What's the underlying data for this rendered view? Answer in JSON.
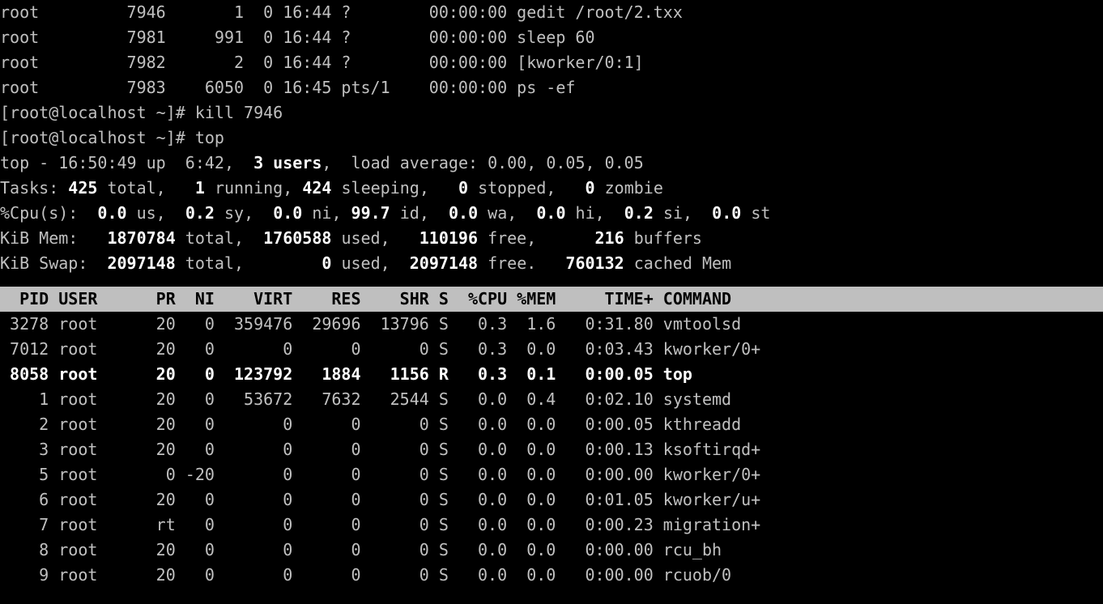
{
  "ps_rows": [
    {
      "user": "root",
      "pid": "7946",
      "ppid": "1",
      "c": "0",
      "stime": "16:44",
      "tty": "?",
      "time": "00:00:00",
      "cmd": "gedit /root/2.txx"
    },
    {
      "user": "root",
      "pid": "7981",
      "ppid": "991",
      "c": "0",
      "stime": "16:44",
      "tty": "?",
      "time": "00:00:00",
      "cmd": "sleep 60"
    },
    {
      "user": "root",
      "pid": "7982",
      "ppid": "2",
      "c": "0",
      "stime": "16:44",
      "tty": "?",
      "time": "00:00:00",
      "cmd": "[kworker/0:1]"
    },
    {
      "user": "root",
      "pid": "7983",
      "ppid": "6050",
      "c": "0",
      "stime": "16:45",
      "tty": "pts/1",
      "time": "00:00:00",
      "cmd": "ps -ef"
    }
  ],
  "prompts": [
    {
      "prompt": "[root@localhost ~]# ",
      "cmd": "kill 7946"
    },
    {
      "prompt": "[root@localhost ~]# ",
      "cmd": "top"
    }
  ],
  "top_summary": {
    "l1a": "top - 16:50:49 up  6:42,  ",
    "l1b": "3 users",
    "l1c": ",  load average: 0.00, 0.05, 0.05",
    "l2a": "Tasks: ",
    "l2b": "425 ",
    "l2c": "total,   ",
    "l2d": "1 ",
    "l2e": "running, ",
    "l2f": "424 ",
    "l2g": "sleeping,   ",
    "l2h": "0 ",
    "l2i": "stopped,   ",
    "l2j": "0 ",
    "l2k": "zombie",
    "l3a": "%Cpu(s):  ",
    "l3b": "0.0 ",
    "l3c": "us,  ",
    "l3d": "0.2 ",
    "l3e": "sy,  ",
    "l3f": "0.0 ",
    "l3g": "ni, ",
    "l3h": "99.7 ",
    "l3i": "id,  ",
    "l3j": "0.0 ",
    "l3k": "wa,  ",
    "l3l": "0.0 ",
    "l3m": "hi,  ",
    "l3n": "0.2 ",
    "l3o": "si,  ",
    "l3p": "0.0 ",
    "l3q": "st",
    "l4a": "KiB Mem:   ",
    "l4b": "1870784 ",
    "l4c": "total,  ",
    "l4d": "1760588 ",
    "l4e": "used,   ",
    "l4f": "110196 ",
    "l4g": "free,      ",
    "l4h": "216 ",
    "l4i": "buffers",
    "l5a": "KiB Swap:  ",
    "l5b": "2097148 ",
    "l5c": "total,        ",
    "l5d": "0 ",
    "l5e": "used,  ",
    "l5f": "2097148 ",
    "l5g": "free.   ",
    "l5h": "760132 ",
    "l5i": "cached Mem"
  },
  "top_header": "  PID USER      PR  NI    VIRT    RES    SHR S  %CPU %MEM     TIME+ COMMAND                                                                                               ",
  "top_rows": [
    {
      "pid": "3278",
      "user": "root",
      "pr": "20",
      "ni": "0",
      "virt": "359476",
      "res": "29696",
      "shr": "13796",
      "s": "S",
      "cpu": "0.3",
      "mem": "1.6",
      "time": "0:31.80",
      "cmd": "vmtoolsd",
      "bold": false
    },
    {
      "pid": "7012",
      "user": "root",
      "pr": "20",
      "ni": "0",
      "virt": "0",
      "res": "0",
      "shr": "0",
      "s": "S",
      "cpu": "0.3",
      "mem": "0.0",
      "time": "0:03.43",
      "cmd": "kworker/0+",
      "bold": false
    },
    {
      "pid": "8058",
      "user": "root",
      "pr": "20",
      "ni": "0",
      "virt": "123792",
      "res": "1884",
      "shr": "1156",
      "s": "R",
      "cpu": "0.3",
      "mem": "0.1",
      "time": "0:00.05",
      "cmd": "top",
      "bold": true
    },
    {
      "pid": "1",
      "user": "root",
      "pr": "20",
      "ni": "0",
      "virt": "53672",
      "res": "7632",
      "shr": "2544",
      "s": "S",
      "cpu": "0.0",
      "mem": "0.4",
      "time": "0:02.10",
      "cmd": "systemd",
      "bold": false
    },
    {
      "pid": "2",
      "user": "root",
      "pr": "20",
      "ni": "0",
      "virt": "0",
      "res": "0",
      "shr": "0",
      "s": "S",
      "cpu": "0.0",
      "mem": "0.0",
      "time": "0:00.05",
      "cmd": "kthreadd",
      "bold": false
    },
    {
      "pid": "3",
      "user": "root",
      "pr": "20",
      "ni": "0",
      "virt": "0",
      "res": "0",
      "shr": "0",
      "s": "S",
      "cpu": "0.0",
      "mem": "0.0",
      "time": "0:00.13",
      "cmd": "ksoftirqd+",
      "bold": false
    },
    {
      "pid": "5",
      "user": "root",
      "pr": "0",
      "ni": "-20",
      "virt": "0",
      "res": "0",
      "shr": "0",
      "s": "S",
      "cpu": "0.0",
      "mem": "0.0",
      "time": "0:00.00",
      "cmd": "kworker/0+",
      "bold": false
    },
    {
      "pid": "6",
      "user": "root",
      "pr": "20",
      "ni": "0",
      "virt": "0",
      "res": "0",
      "shr": "0",
      "s": "S",
      "cpu": "0.0",
      "mem": "0.0",
      "time": "0:01.05",
      "cmd": "kworker/u+",
      "bold": false
    },
    {
      "pid": "7",
      "user": "root",
      "pr": "rt",
      "ni": "0",
      "virt": "0",
      "res": "0",
      "shr": "0",
      "s": "S",
      "cpu": "0.0",
      "mem": "0.0",
      "time": "0:00.23",
      "cmd": "migration+",
      "bold": false
    },
    {
      "pid": "8",
      "user": "root",
      "pr": "20",
      "ni": "0",
      "virt": "0",
      "res": "0",
      "shr": "0",
      "s": "S",
      "cpu": "0.0",
      "mem": "0.0",
      "time": "0:00.00",
      "cmd": "rcu_bh",
      "bold": false
    },
    {
      "pid": "9",
      "user": "root",
      "pr": "20",
      "ni": "0",
      "virt": "0",
      "res": "0",
      "shr": "0",
      "s": "S",
      "cpu": "0.0",
      "mem": "0.0",
      "time": "0:00.00",
      "cmd": "rcuob/0",
      "bold": false
    }
  ]
}
